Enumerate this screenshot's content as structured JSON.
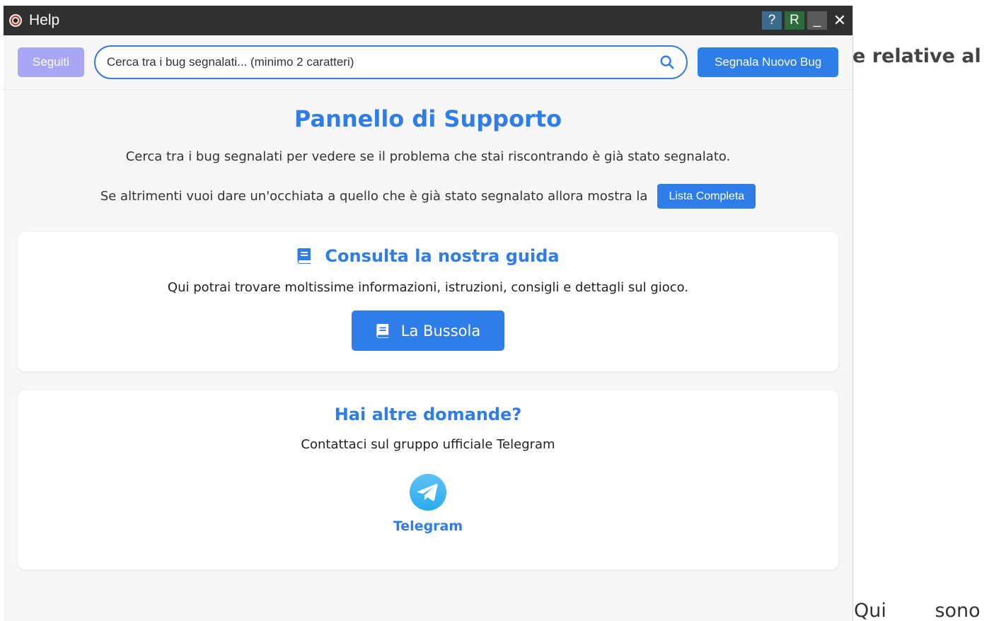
{
  "background": {
    "heading_fragment": "e relative al",
    "text_fragment": "Qui sono"
  },
  "window": {
    "title": "Help",
    "buttons": {
      "help": "?",
      "refresh": "R",
      "minimize": "_",
      "close": "✕"
    }
  },
  "toolbar": {
    "followed_label": "Seguiti",
    "search_placeholder": "Cerca tra i bug segnalati... (minimo 2 caratteri)",
    "report_label": "Segnala Nuovo Bug"
  },
  "main": {
    "title": "Pannello di Supporto",
    "intro": "Cerca tra i bug segnalati per vedere se il problema che stai riscontrando è già stato segnalato.",
    "intro2": "Se altrimenti vuoi dare un'occhiata a quello che è già stato segnalato allora mostra la",
    "list_button": "Lista Completa"
  },
  "guide": {
    "title": "Consulta la nostra guida",
    "text": "Qui potrai trovare moltissime informazioni, istruzioni, consigli e dettagli sul gioco.",
    "button": "La Bussola"
  },
  "contact": {
    "title": "Hai altre domande?",
    "text": "Contattaci sul gruppo ufficiale Telegram",
    "telegram_label": "Telegram"
  },
  "colors": {
    "accent": "#2f7de8",
    "followed_button": "#a9a7f5",
    "titlebar": "#303030",
    "telegram": "#2aabee"
  }
}
